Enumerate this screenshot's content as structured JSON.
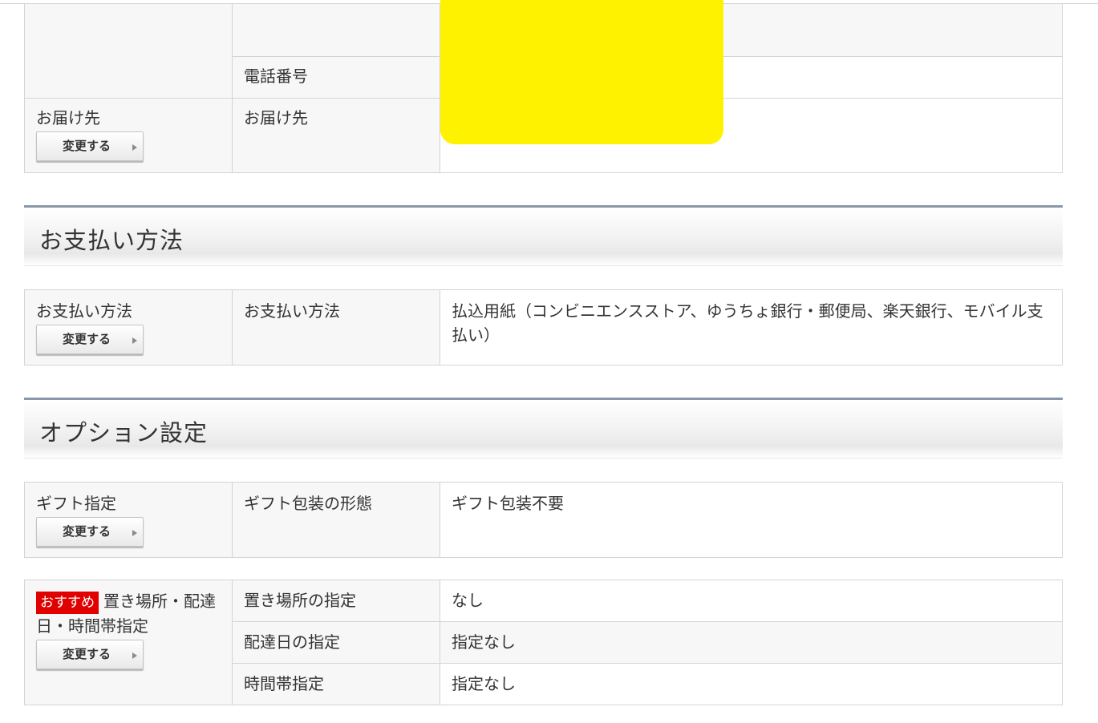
{
  "address_block": {
    "phone_label": "電話番号",
    "delivery_label": "お届け先",
    "delivery_field": "お届け先",
    "change_label": "変更する"
  },
  "payment": {
    "section_title": "お支払い方法",
    "row_label": "お支払い方法",
    "field": "お支払い方法",
    "value": "払込用紙（コンビニエンスストア、ゆうちょ銀行・郵便局、楽天銀行、モバイル支払い）",
    "change_label": "変更する"
  },
  "options": {
    "section_title": "オプション設定",
    "gift": {
      "row_label": "ギフト指定",
      "field": "ギフト包装の形態",
      "value": "ギフト包装不要",
      "change_label": "変更する"
    },
    "delivery": {
      "badge": "おすすめ",
      "row_label": "置き場所・配達日・時間帯指定",
      "change_label": "変更する",
      "rows": [
        {
          "field": "置き場所の指定",
          "value": "なし"
        },
        {
          "field": "配達日の指定",
          "value": "指定なし"
        },
        {
          "field": "時間帯指定",
          "value": "指定なし"
        }
      ]
    }
  },
  "colors": {
    "redaction": "#fff200",
    "badge": "#e00000",
    "section_border": "#8a97aa"
  }
}
